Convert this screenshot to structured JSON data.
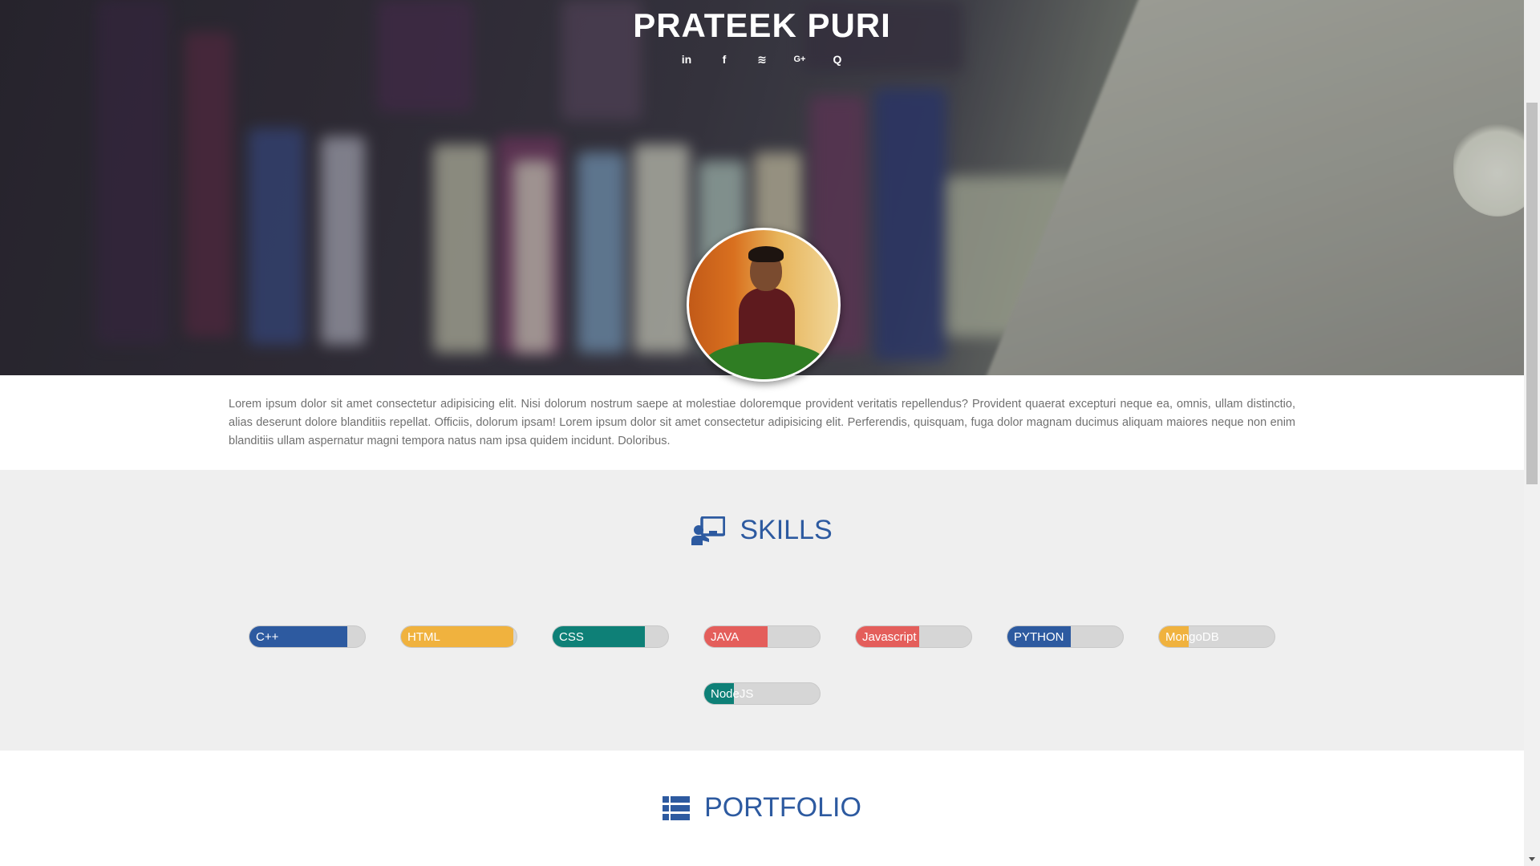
{
  "hero": {
    "title": "PRATEEK PURI",
    "social_links": [
      {
        "icon": "linkedin-icon",
        "glyph": "in"
      },
      {
        "icon": "facebook-icon",
        "glyph": "f"
      },
      {
        "icon": "stackoverflow-icon",
        "glyph": "≋"
      },
      {
        "icon": "google-plus-icon",
        "glyph": "G+"
      },
      {
        "icon": "quora-icon",
        "glyph": "Q"
      }
    ]
  },
  "intro": {
    "text": "Lorem ipsum dolor sit amet consectetur adipisicing elit. Nisi dolorum nostrum saepe at molestiae doloremque provident veritatis repellendus? Provident quaerat excepturi neque ea, omnis, ullam distinctio, alias deserunt dolore blanditiis repellat. Officiis, dolorum ipsam! Lorem ipsum dolor sit amet consectetur adipisicing elit. Perferendis, quisquam, fuga dolor magnam ducimus aliquam maiores neque non enim blanditiis ullam aspernatur magni tempora natus nam ipsa quidem incidunt. Doloribus."
  },
  "skills": {
    "heading": "SKILLS",
    "icon": "chalkboard-teacher-icon",
    "items": [
      {
        "name": "C++",
        "level": 0.85,
        "color": "#2d5aa0"
      },
      {
        "name": "HTML",
        "level": 0.97,
        "color": "#f0b23e"
      },
      {
        "name": "CSS",
        "level": 0.8,
        "color": "#0e8077"
      },
      {
        "name": "JAVA",
        "level": 0.55,
        "color": "#e45e5b"
      },
      {
        "name": "Javascript",
        "level": 0.55,
        "color": "#e45e5b"
      },
      {
        "name": "PYTHON",
        "level": 0.55,
        "color": "#2d5aa0"
      },
      {
        "name": "MongoDB",
        "level": 0.26,
        "color": "#f0b23e"
      },
      {
        "name": "NodeJS",
        "level": 0.26,
        "color": "#0e8077"
      }
    ]
  },
  "portfolio": {
    "heading": "PORTFOLIO",
    "icon": "list-icon"
  }
}
